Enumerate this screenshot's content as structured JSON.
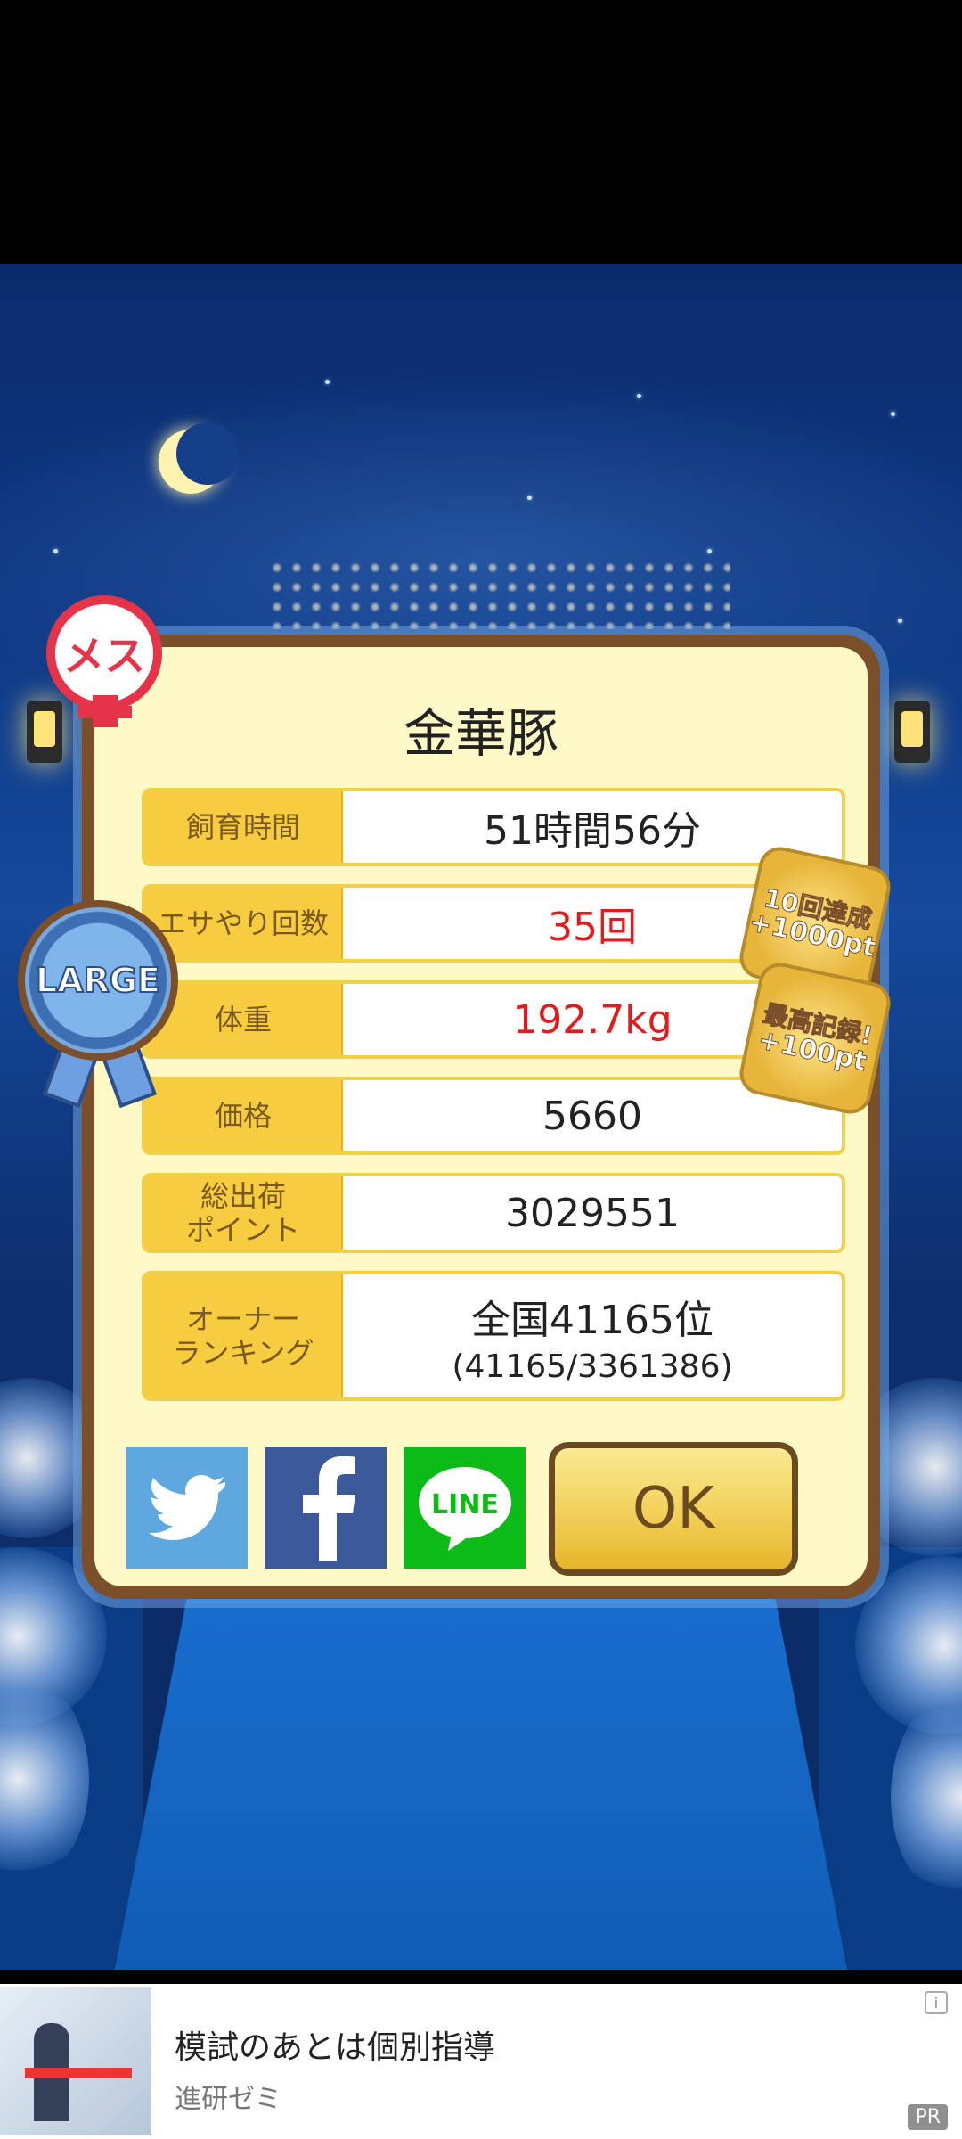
{
  "result": {
    "title": "金華豚",
    "rows": [
      {
        "label": "飼育時間",
        "value": "51時間56分"
      },
      {
        "label": "エサやり回数",
        "value": "35回"
      },
      {
        "label": "体重",
        "value": "192.7kg"
      },
      {
        "label": "価格",
        "value": "5660"
      },
      {
        "label": "総出荷\nポイント",
        "value": "3029551"
      },
      {
        "label": "オーナー\nランキング",
        "value": "全国41165位",
        "sub": "(41165/3361386)"
      }
    ],
    "highlight_color": "#e21c1c"
  },
  "badges": {
    "gender": "メス",
    "size": "LARGE",
    "achievement1": {
      "line1": "10回達成",
      "line2": "+1000pt"
    },
    "achievement2": {
      "line1": "最高記録!",
      "line2": "+100pt"
    }
  },
  "actions": {
    "twitter_icon": "twitter-icon",
    "facebook_icon": "facebook-icon",
    "line_label": "LINE",
    "ok_label": "OK"
  },
  "ad": {
    "title": "模試のあとは個別指導",
    "sponsor": "進研ゼミ",
    "pr_label": "PR",
    "info_label": "i"
  }
}
